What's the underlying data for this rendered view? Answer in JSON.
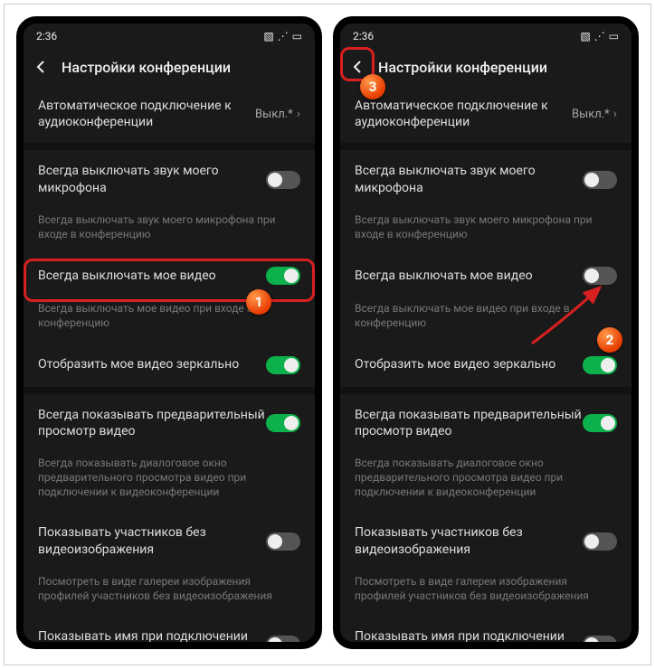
{
  "statusbar": {
    "time": "2:36"
  },
  "header": {
    "title": "Настройки конференции"
  },
  "rows": {
    "autoconnect": {
      "label": "Автоматическое подключение к аудиоконференции",
      "value": "Выкл.*"
    },
    "muteMic": {
      "label": "Всегда выключать звук моего микрофона",
      "desc": "Всегда выключать звук моего микрофона при входе в конференцию"
    },
    "muteVideo": {
      "label": "Всегда выключать мое видео",
      "desc": "Всегда выключать мое видео при входе в конференцию"
    },
    "mirror": {
      "label": "Отобразить мое видео зеркально"
    },
    "preview": {
      "label": "Всегда показывать предварительный просмотр видео",
      "desc": "Всегда показывать диалоговое окно предварительного просмотра видео при подключении к видеоконференции"
    },
    "noVideo": {
      "label": "Показывать участников без видеоизображения",
      "desc": "Посмотреть в виде галереи изображения профилей участников без видеоизображения"
    },
    "showName": {
      "label": "Показывать имя при подключении участников"
    }
  },
  "callouts": {
    "c1": "1",
    "c2": "2",
    "c3": "3"
  }
}
